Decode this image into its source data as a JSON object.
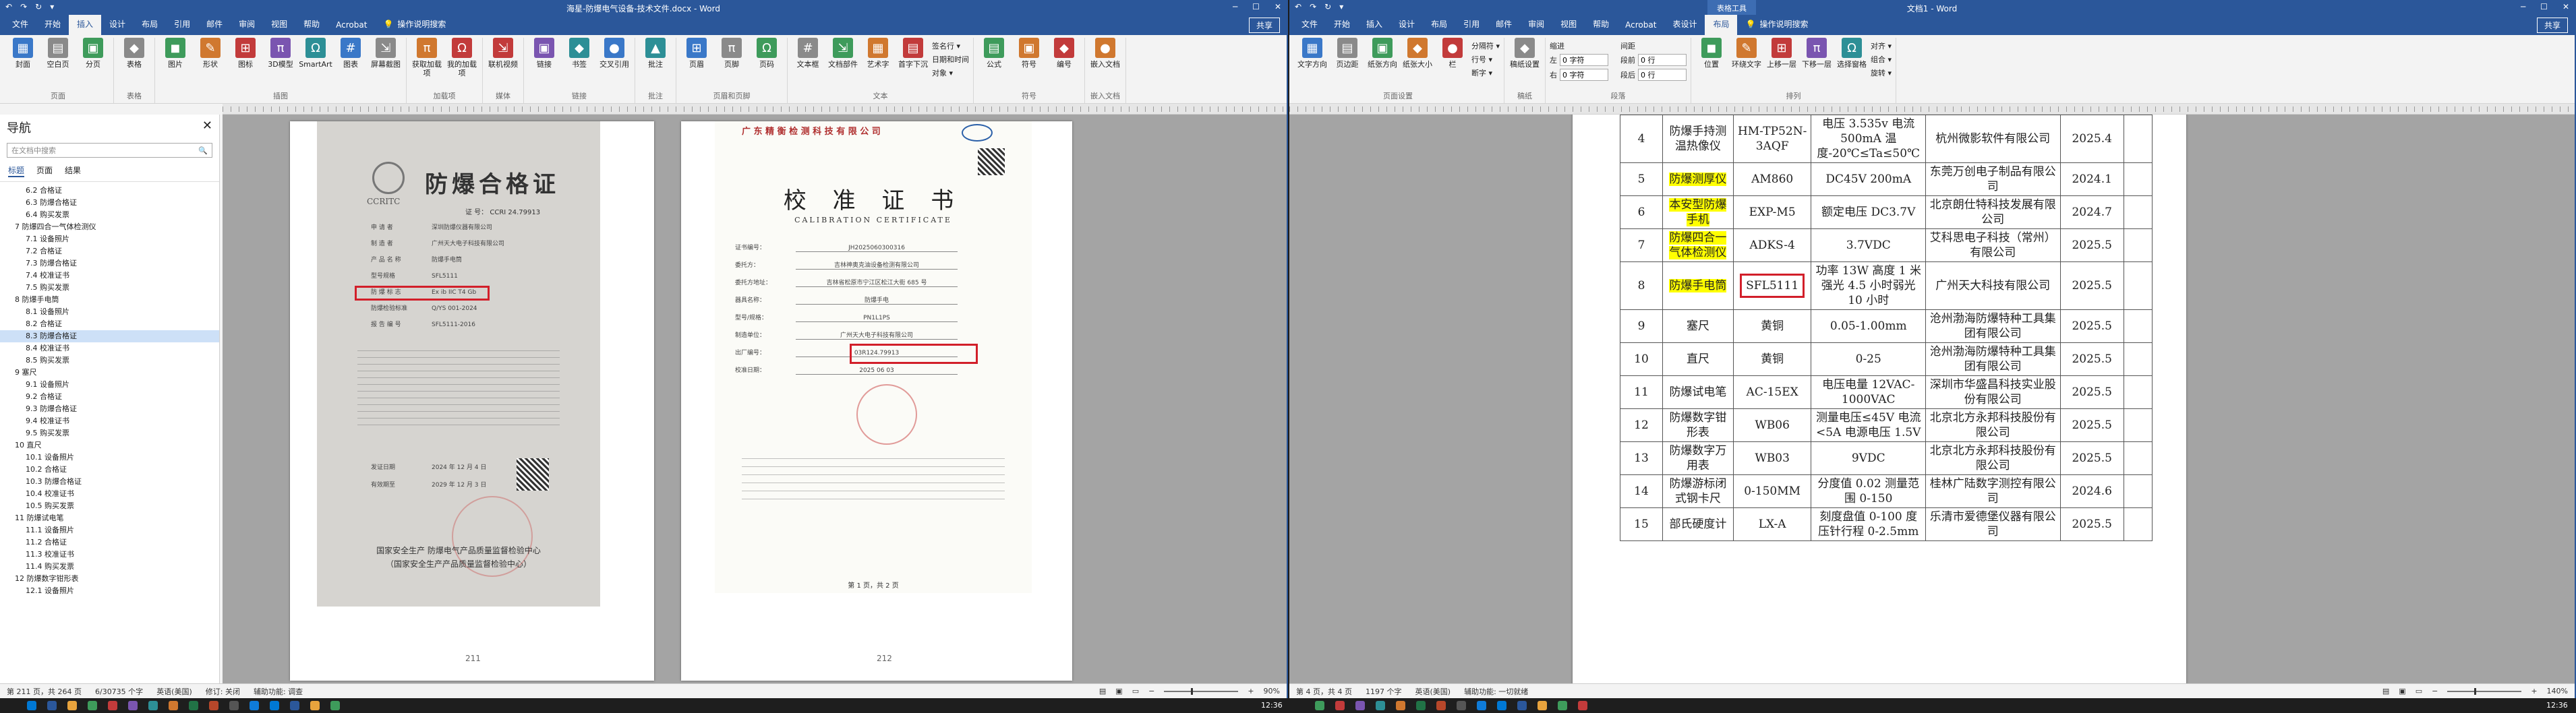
{
  "left": {
    "title": "海星-防爆电气设备-技术文件.docx - Word",
    "quick_access": [
      "↶",
      "↷",
      "↻",
      "▾"
    ],
    "window_controls": [
      "─",
      "☐",
      "✕"
    ],
    "tabs": [
      "文件",
      "开始",
      "插入",
      "设计",
      "布局",
      "引用",
      "邮件",
      "审阅",
      "视图",
      "帮助",
      "Acrobat"
    ],
    "active_tab": "插入",
    "tell_me": "操作说明搜索",
    "share": "共享",
    "ribbon_groups": [
      {
        "label": "页面",
        "buttons": [
          "封面",
          "空白页",
          "分页"
        ]
      },
      {
        "label": "表格",
        "buttons": [
          "表格"
        ]
      },
      {
        "label": "插图",
        "buttons": [
          "图片",
          "形状",
          "图标",
          "3D模型",
          "SmartArt",
          "图表",
          "屏幕截图"
        ]
      },
      {
        "label": "加载项",
        "buttons": [
          "获取加载项",
          "我的加载项"
        ]
      },
      {
        "label": "媒体",
        "buttons": [
          "联机视频"
        ]
      },
      {
        "label": "链接",
        "buttons": [
          "链接",
          "书签",
          "交叉引用"
        ]
      },
      {
        "label": "批注",
        "buttons": [
          "批注"
        ]
      },
      {
        "label": "页眉和页脚",
        "buttons": [
          "页眉",
          "页脚",
          "页码"
        ]
      },
      {
        "label": "文本",
        "buttons": [
          "文本框",
          "文档部件",
          "艺术字",
          "首字下沉"
        ]
      },
      {
        "label": "符号",
        "buttons": [
          "公式",
          "符号",
          "编号"
        ]
      },
      {
        "label": "嵌入文档",
        "buttons": [
          "嵌入文档"
        ]
      }
    ],
    "text_small": [
      "签名行 ▾",
      "日期和时间",
      "对象 ▾"
    ],
    "nav": {
      "title": "导航",
      "search_placeholder": "在文档中搜索",
      "tabs": [
        "标题",
        "页面",
        "结果"
      ],
      "items": [
        {
          "t": "6.2 合格证",
          "lvl": 1
        },
        {
          "t": "6.3 防爆合格证",
          "lvl": 1
        },
        {
          "t": "6.4 购买发票",
          "lvl": 1
        },
        {
          "t": "7 防爆四合一气体检测仪",
          "lvl": 0
        },
        {
          "t": "7.1 设备照片",
          "lvl": 1
        },
        {
          "t": "7.2 合格证",
          "lvl": 1
        },
        {
          "t": "7.3 防爆合格证",
          "lvl": 1
        },
        {
          "t": "7.4 校准证书",
          "lvl": 1
        },
        {
          "t": "7.5 购买发票",
          "lvl": 1
        },
        {
          "t": "8 防爆手电筒",
          "lvl": 0
        },
        {
          "t": "8.1 设备照片",
          "lvl": 1
        },
        {
          "t": "8.2 合格证",
          "lvl": 1
        },
        {
          "t": "8.3 防爆合格证",
          "lvl": 1,
          "sel": true
        },
        {
          "t": "8.4 校准证书",
          "lvl": 1
        },
        {
          "t": "8.5 购买发票",
          "lvl": 1
        },
        {
          "t": "9 塞尺",
          "lvl": 0
        },
        {
          "t": "9.1 设备照片",
          "lvl": 1
        },
        {
          "t": "9.2 合格证",
          "lvl": 1
        },
        {
          "t": "9.3 防爆合格证",
          "lvl": 1
        },
        {
          "t": "9.4 校准证书",
          "lvl": 1
        },
        {
          "t": "9.5 购买发票",
          "lvl": 1
        },
        {
          "t": "10 直尺",
          "lvl": 0
        },
        {
          "t": "10.1 设备照片",
          "lvl": 1
        },
        {
          "t": "10.2 合格证",
          "lvl": 1
        },
        {
          "t": "10.3 防爆合格证",
          "lvl": 1
        },
        {
          "t": "10.4 校准证书",
          "lvl": 1
        },
        {
          "t": "10.5 购买发票",
          "lvl": 1
        },
        {
          "t": "11 防爆试电笔",
          "lvl": 0
        },
        {
          "t": "11.1 设备照片",
          "lvl": 1
        },
        {
          "t": "11.2 合格证",
          "lvl": 1
        },
        {
          "t": "11.3 校准证书",
          "lvl": 1
        },
        {
          "t": "11.4 购买发票",
          "lvl": 1
        },
        {
          "t": "12 防爆数字钳形表",
          "lvl": 0
        },
        {
          "t": "12.1 设备照片",
          "lvl": 1
        }
      ]
    },
    "cert1": {
      "logo": "CCRITC",
      "title": "防爆合格证",
      "number": "证 号：  CCRI 24.79913",
      "rows": [
        [
          "申 请 者",
          "深圳防爆仪器有限公司"
        ],
        [
          "制 造 者",
          "广州天大电子科技有限公司"
        ],
        [
          "产 品 名 称",
          "防爆手电筒"
        ],
        [
          "型号规格",
          "SFL5111"
        ],
        [
          "防 爆 标 志",
          "Ex ib IIC T4 Gb"
        ],
        [
          "防爆检验标准",
          "Q/YS 001-2024"
        ],
        [
          "报 告 编 号",
          "SFL5111-2016"
        ]
      ],
      "issued_label": "发证日期",
      "issued": "2024 年 12 月 4 日",
      "valid_label": "有效期至",
      "valid": "2029 年 12 月 3 日",
      "footer1": "国家安全生产 防爆电气产品质量监督检验中心",
      "footer2": "（国家安全生产产品质量监督检验中心）"
    },
    "cert2": {
      "org": "广 东 精 衡 检 测 科 技 有 限 公 司",
      "title": "校 准 证 书",
      "subtitle": "CALIBRATION CERTIFICATE",
      "lines": [
        [
          "证书编号：",
          "JH2025060300316"
        ],
        [
          "委托方：",
          "吉林神奥克油设备检测有限公司"
        ],
        [
          "委托方地址：",
          "吉林省松原市宁江区松江大街 685 号"
        ],
        [
          "器具名称：",
          "防爆手电"
        ],
        [
          "型号/规格：",
          "PN1L1PS"
        ],
        [
          "制造单位：",
          "广州天大电子科技有限公司"
        ],
        [
          "出厂编号：",
          "03R124.79913"
        ],
        [
          "校准日期：",
          "2025    06    03"
        ]
      ],
      "page": "第 1 页，共 2 页"
    },
    "page_numbers": [
      "211",
      "212"
    ],
    "status": {
      "page": "第 211 页，共 264 页",
      "words": "6/30735 个字",
      "lang": "英语(美国)",
      "track": "修订: 关闭",
      "access": "辅助功能: 调查",
      "zoom": "90%"
    }
  },
  "right": {
    "title": "文档1 - Word",
    "context_tab": "表格工具",
    "tabs": [
      "文件",
      "开始",
      "插入",
      "设计",
      "布局",
      "引用",
      "邮件",
      "审阅",
      "视图",
      "帮助",
      "Acrobat",
      "表设计",
      "布局"
    ],
    "active_tab": "布局",
    "tell_me": "操作说明搜索",
    "share": "共享",
    "ribbon_groups": [
      {
        "label": "页面设置",
        "buttons": [
          "文字方向",
          "页边距",
          "纸张方向",
          "纸张大小",
          "栏"
        ]
      },
      {
        "label": "稿纸",
        "buttons": [
          "稿纸设置"
        ]
      },
      {
        "label": "排列",
        "buttons": [
          "位置",
          "环绕文字",
          "上移一层",
          "下移一层",
          "选择窗格"
        ]
      }
    ],
    "indent": {
      "left_label": "左",
      "left": "0 字符",
      "right_label": "右",
      "right": "0 字符"
    },
    "spacing": {
      "before_label": "段前",
      "before": "0 行",
      "after_label": "段后",
      "after": "0 行"
    },
    "small": [
      "分隔符 ▾",
      "行号 ▾",
      "断字 ▾",
      "对齐 ▾",
      "组合 ▾",
      "旋转 ▾"
    ],
    "table_rows": [
      {
        "no": "4",
        "name": "防爆手持测温热像仪",
        "hl": false,
        "model": "HM-TP52N-3AQF",
        "spec": "电压 3.535v 电流 500mA 温度-20℃≤Ta≤50℃",
        "maker": "杭州微影软件有限公司",
        "date": "2025.4"
      },
      {
        "no": "5",
        "name": "防爆测厚仪",
        "hl": true,
        "model": "AM860",
        "spec": "DC45V 200mA",
        "maker": "东莞万创电子制品有限公司",
        "date": "2024.1"
      },
      {
        "no": "6",
        "name": "本安型防爆手机",
        "hl": true,
        "model": "EXP-M5",
        "spec": "额定电压 DC3.7V",
        "maker": "北京朗仕特科技发展有限公司",
        "date": "2024.7"
      },
      {
        "no": "7",
        "name": "防爆四合一气体检测仪",
        "hl": true,
        "model": "ADKS-4",
        "spec": "3.7VDC",
        "maker": "艾科思电子科技（常州）有限公司",
        "date": "2025.5"
      },
      {
        "no": "8",
        "name": "防爆手电筒",
        "hl": true,
        "model": "SFL5111",
        "boxed": true,
        "spec": "功率 13W 高度 1 米 强光 4.5 小时弱光 10 小时",
        "maker": "广州天大科技有限公司",
        "date": "2025.5"
      },
      {
        "no": "9",
        "name": "塞尺",
        "hl": false,
        "model": "黄铜",
        "spec": "0.05-1.00mm",
        "maker": "沧州渤海防爆特种工具集团有限公司",
        "date": "2025.5"
      },
      {
        "no": "10",
        "name": "直尺",
        "hl": false,
        "model": "黄铜",
        "spec": "0-25",
        "maker": "沧州渤海防爆特种工具集团有限公司",
        "date": "2025.5"
      },
      {
        "no": "11",
        "name": "防爆试电笔",
        "hl": false,
        "model": "AC-15EX",
        "spec": "电压电量 12VAC-1000VAC",
        "maker": "深圳市华盛昌科技实业股份有限公司",
        "date": "2025.5"
      },
      {
        "no": "12",
        "name": "防爆数字钳形表",
        "hl": false,
        "model": "WB06",
        "spec": "测量电压≤45V 电流<5A 电源电压 1.5V",
        "maker": "北京北方永邦科技股份有限公司",
        "date": "2025.5"
      },
      {
        "no": "13",
        "name": "防爆数字万用表",
        "hl": false,
        "model": "WB03",
        "spec": "9VDC",
        "maker": "北京北方永邦科技股份有限公司",
        "date": "2025.5"
      },
      {
        "no": "14",
        "name": "防爆游标闭式钢卡尺",
        "hl": false,
        "model": "0-150MM",
        "spec": "分度值 0.02 测量范围 0-150",
        "maker": "桂林广陆数字测控有限公司",
        "date": "2024.6"
      },
      {
        "no": "15",
        "name": "部氏硬度计",
        "hl": false,
        "model": "LX-A",
        "spec": "刻度盘值 0-100 度 压针行程 0-2.5mm",
        "maker": "乐清市爱德堡仪器有限公司",
        "date": "2025.5"
      }
    ],
    "status": {
      "page": "第 4 页，共 4 页",
      "words": "1197 个字",
      "lang": "英语(美国)",
      "access": "辅助功能: 一切就绪",
      "zoom": "140%"
    }
  },
  "taskbar": {
    "time_left": "12:36",
    "time_right": "12:36"
  }
}
